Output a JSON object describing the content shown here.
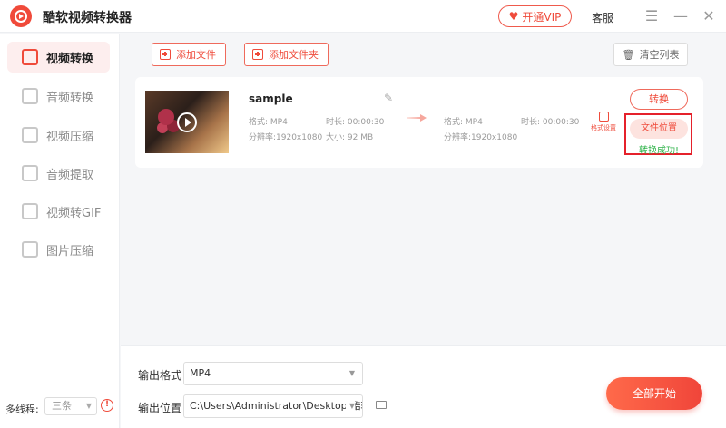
{
  "app": {
    "title": "酷软视频转换器",
    "vip_label": "开通VIP",
    "service_label": "客服"
  },
  "sidebar": {
    "items": [
      {
        "label": "视频转换",
        "active": true
      },
      {
        "label": "音频转换",
        "active": false
      },
      {
        "label": "视频压缩",
        "active": false
      },
      {
        "label": "音频提取",
        "active": false
      },
      {
        "label": "视频转GIF",
        "active": false
      },
      {
        "label": "图片压缩",
        "active": false
      }
    ],
    "multithread_label": "多线程:",
    "multithread_value": "三条"
  },
  "toolbar": {
    "add_file": "添加文件",
    "add_folder": "添加文件夹",
    "clear_list": "清空列表"
  },
  "file": {
    "name": "sample",
    "source": {
      "format": "格式: MP4",
      "duration": "时长: 00:00:30",
      "resolution": "分辨率:1920x1080",
      "size": "大小: 92 MB"
    },
    "target": {
      "format": "格式: MP4",
      "duration": "时长: 00:00:30",
      "resolution": "分辨率:1920x1080"
    },
    "format_setting": "格式设置",
    "convert_label": "转换",
    "file_location_label": "文件位置",
    "status": "转换成功!"
  },
  "output": {
    "format_label": "输出格式",
    "format_value": "MP4",
    "location_label": "输出位置",
    "location_value": "C:\\Users\\Administrator\\Desktop\\酷软"
  },
  "start_all_label": "全部开始"
}
